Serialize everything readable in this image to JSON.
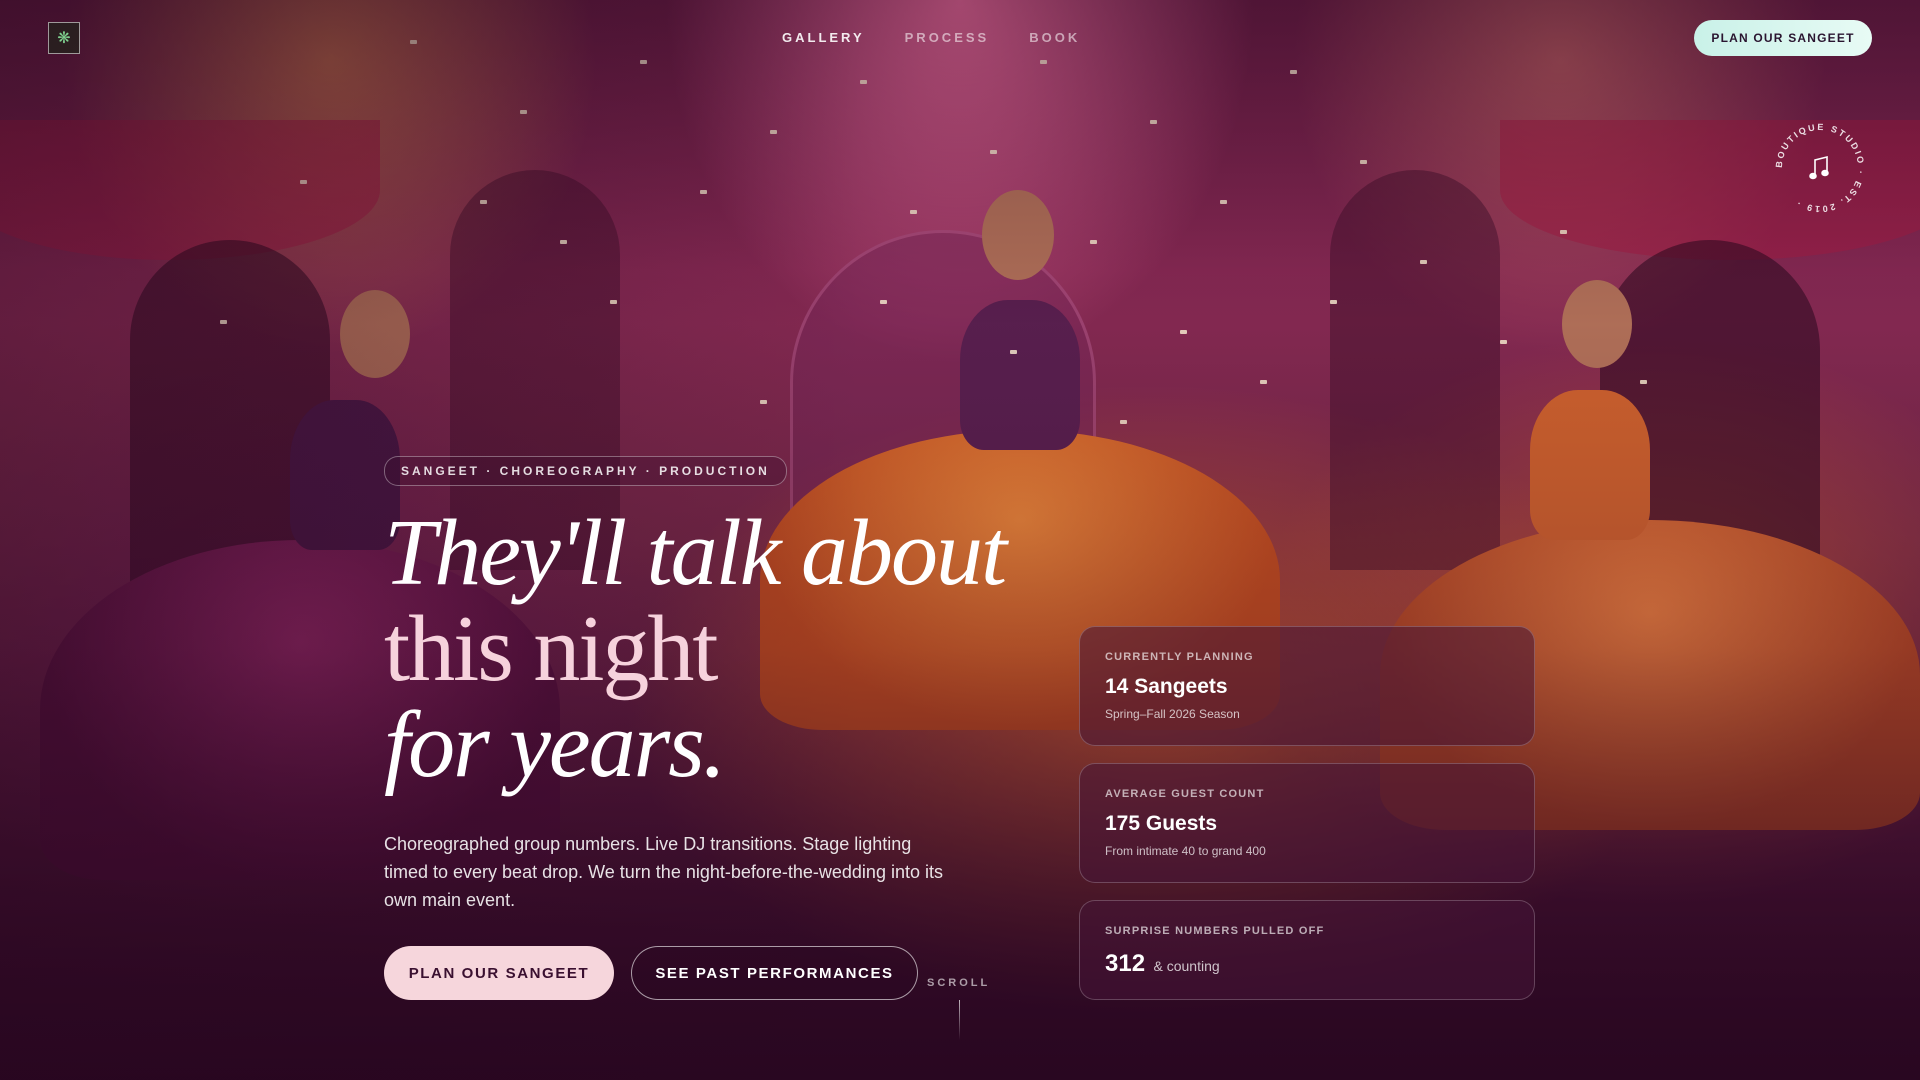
{
  "nav": {
    "items": [
      {
        "label": "GALLERY"
      },
      {
        "label": "PROCESS"
      },
      {
        "label": "BOOK"
      }
    ],
    "cta_label": "PLAN OUR SANGEET"
  },
  "badge": {
    "ring_text": "BOUTIQUE STUDIO · EST. 2019 ·",
    "icon": "music-note-icon"
  },
  "hero": {
    "eyebrow": "SANGEET · CHOREOGRAPHY · PRODUCTION",
    "headline_line1": "They'll talk about",
    "headline_line2": "this night",
    "headline_line3": "for years.",
    "lede": "Choreographed group numbers. Live DJ transitions. Stage lighting timed to every beat drop. We turn the night-before-the-wedding into its own main event.",
    "primary_cta": "PLAN OUR SANGEET",
    "secondary_cta": "SEE PAST PERFORMANCES",
    "scroll_label": "SCROLL"
  },
  "stats": [
    {
      "label": "CURRENTLY PLANNING",
      "value": "14 Sangeets",
      "sub": "Spring–Fall 2026 Season"
    },
    {
      "label": "AVERAGE GUEST COUNT",
      "value": "175 Guests",
      "sub": "From intimate 40 to grand 400"
    },
    {
      "label": "SURPRISE NUMBERS PULLED OFF",
      "value": "312",
      "suffix": "& counting"
    }
  ],
  "colors": {
    "accent_pink": "#f6d6dc",
    "accent_mint": "#c9f1e8",
    "deep_plum": "#3a1030"
  }
}
